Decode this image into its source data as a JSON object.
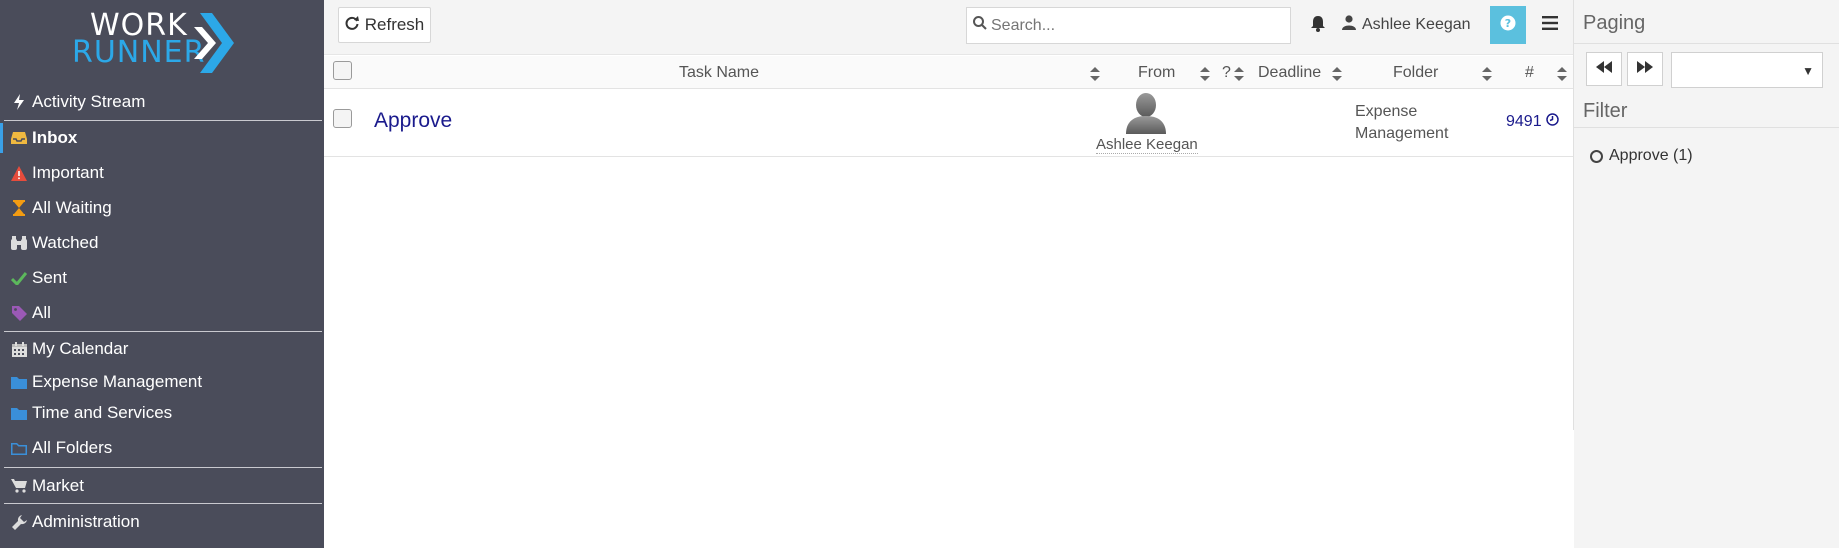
{
  "logo": {
    "line1": "WORK",
    "line2": "RUNNER"
  },
  "sidebar": {
    "items": [
      {
        "label": "Activity Stream",
        "icon": "bolt-icon"
      },
      {
        "label": "Inbox",
        "icon": "inbox-icon",
        "active": true
      },
      {
        "label": "Important",
        "icon": "warning-icon"
      },
      {
        "label": "All Waiting",
        "icon": "hourglass-icon"
      },
      {
        "label": "Watched",
        "icon": "binoculars-icon"
      },
      {
        "label": "Sent",
        "icon": "check-icon"
      },
      {
        "label": "All",
        "icon": "tag-icon"
      },
      {
        "label": "My Calendar",
        "icon": "calendar-icon"
      },
      {
        "label": "Expense Management",
        "icon": "folder-icon"
      },
      {
        "label": "Time and Services",
        "icon": "folder-icon"
      },
      {
        "label": "All Folders",
        "icon": "folder-open-icon"
      },
      {
        "label": "Market",
        "icon": "cart-icon"
      },
      {
        "label": "Administration",
        "icon": "wrench-icon"
      }
    ]
  },
  "toolbar": {
    "refresh_label": "Refresh",
    "search_placeholder": "Search...",
    "user_name": "Ashlee Keegan"
  },
  "table": {
    "headers": {
      "task": "Task Name",
      "from": "From",
      "q": "?",
      "deadline": "Deadline",
      "folder": "Folder",
      "num": "#"
    },
    "rows": [
      {
        "task": "Approve",
        "from": "Ashlee Keegan",
        "folder": "Expense Management",
        "num": "9491"
      }
    ]
  },
  "right": {
    "paging_title": "Paging",
    "filter_title": "Filter",
    "filter_items": [
      {
        "label": "Approve (1)"
      }
    ]
  },
  "colors": {
    "sidebar_bg": "#4a4c5a",
    "accent": "#2ca8e8",
    "help_btn": "#5bc0de",
    "link": "#1a1a8c"
  }
}
